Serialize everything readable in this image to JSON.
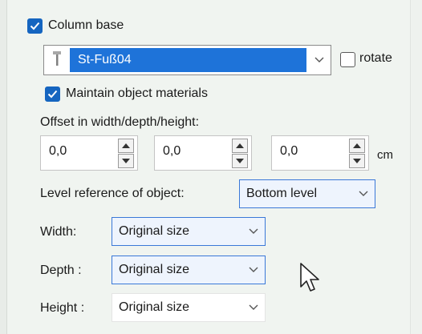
{
  "column_base": {
    "checkbox_label": "Column base",
    "checked": true,
    "selected_value": "St-Fuß04",
    "rotate_label": "rotate",
    "rotate_checked": false
  },
  "maintain_materials": {
    "label": "Maintain object materials",
    "checked": true
  },
  "offset": {
    "label": "Offset in width/depth/height:",
    "width_value": "0,0",
    "depth_value": "0,0",
    "height_value": "0,0",
    "unit": "cm"
  },
  "level_reference": {
    "label": "Level reference of object:",
    "selected": "Bottom level"
  },
  "dimensions": {
    "width_label": "Width:",
    "width_value": "Original size",
    "depth_label": "Depth :",
    "depth_value": "Original size",
    "height_label": "Height :",
    "height_value": "Original size"
  },
  "colors": {
    "accent": "#1565c0",
    "selection": "#1e73d9",
    "focus_border": "#3a78d8"
  },
  "icons": [
    "checkmark-icon",
    "column-base-icon",
    "chevron-down-icon",
    "spin-up-icon",
    "spin-down-icon",
    "mouse-pointer-icon"
  ]
}
